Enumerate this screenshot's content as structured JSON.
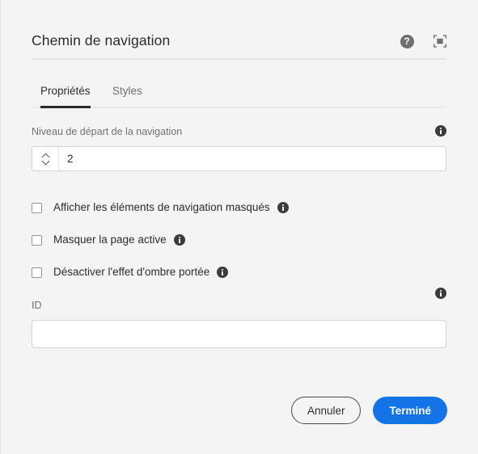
{
  "dialog": {
    "title": "Chemin de navigation",
    "background_color": "#f4f4f4"
  },
  "header": {
    "help_icon": "help-circle-icon",
    "help_glyph": "?",
    "fullscreen_icon": "fullscreen-expand-icon"
  },
  "tabs": {
    "items": [
      {
        "label": "Propriétés",
        "active": true
      },
      {
        "label": "Styles",
        "active": false
      }
    ]
  },
  "fields": {
    "nav_start_level": {
      "label": "Niveau de départ de la navigation",
      "value": "2",
      "placeholder": "",
      "info_icon": "info-icon"
    },
    "id": {
      "label": "ID",
      "value": "",
      "placeholder": "",
      "info_icon": "info-icon"
    }
  },
  "checkboxes": [
    {
      "label": "Afficher les éléments de navigation masqués",
      "checked": false,
      "info_icon": "info-icon"
    },
    {
      "label": "Masquer la page active",
      "checked": false,
      "info_icon": "info-icon"
    },
    {
      "label": "Désactiver l'effet d'ombre portée",
      "checked": false,
      "info_icon": "info-icon"
    }
  ],
  "footer": {
    "cancel_label": "Annuler",
    "done_label": "Terminé",
    "primary_color": "#1473e6"
  }
}
